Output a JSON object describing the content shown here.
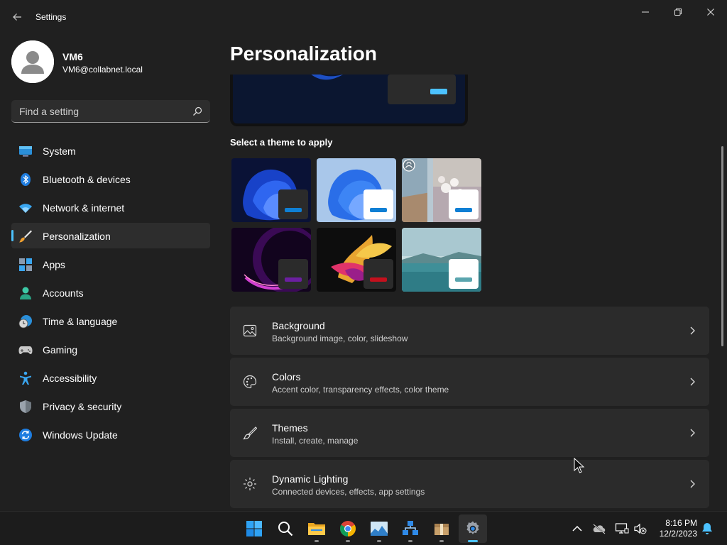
{
  "window": {
    "title": "Settings",
    "back_icon": "back-arrow-icon",
    "controls": [
      "minimize-icon",
      "restore-icon",
      "close-icon"
    ]
  },
  "profile": {
    "name": "VM6",
    "email": "VM6@collabnet.local"
  },
  "search": {
    "placeholder": "Find a setting",
    "value": ""
  },
  "sidebar": {
    "items": [
      {
        "label": "System",
        "icon": "system-monitor-icon"
      },
      {
        "label": "Bluetooth & devices",
        "icon": "bluetooth-icon"
      },
      {
        "label": "Network & internet",
        "icon": "wifi-icon"
      },
      {
        "label": "Personalization",
        "icon": "paintbrush-icon",
        "active": true
      },
      {
        "label": "Apps",
        "icon": "apps-icon"
      },
      {
        "label": "Accounts",
        "icon": "account-icon"
      },
      {
        "label": "Time & language",
        "icon": "clock-globe-icon"
      },
      {
        "label": "Gaming",
        "icon": "gamepad-icon"
      },
      {
        "label": "Accessibility",
        "icon": "accessibility-icon"
      },
      {
        "label": "Privacy & security",
        "icon": "shield-icon"
      },
      {
        "label": "Windows Update",
        "icon": "update-icon"
      }
    ]
  },
  "main": {
    "title": "Personalization",
    "theme_heading": "Select a theme to apply",
    "themes": [
      {
        "name": "windows-dark",
        "accent": "#0f7fd4",
        "window": "#2b2b2b"
      },
      {
        "name": "windows-light",
        "accent": "#0f7fd4",
        "window": "#ffffff"
      },
      {
        "name": "spotlight",
        "accent": "#0f7fd4",
        "window": "#ffffff"
      },
      {
        "name": "glow",
        "accent": "#6b1fa0",
        "window": "#2b2b2b"
      },
      {
        "name": "captured-motion",
        "accent": "#c4101d",
        "window": "#2b2b2b"
      },
      {
        "name": "flow",
        "accent": "#5aa5ae",
        "window": "#ffffff"
      }
    ],
    "cards": [
      {
        "title": "Background",
        "subtitle": "Background image, color, slideshow",
        "icon": "image-icon"
      },
      {
        "title": "Colors",
        "subtitle": "Accent color, transparency effects, color theme",
        "icon": "palette-icon"
      },
      {
        "title": "Themes",
        "subtitle": "Install, create, manage",
        "icon": "brush-icon"
      },
      {
        "title": "Dynamic Lighting",
        "subtitle": "Connected devices, effects, app settings",
        "icon": "lighting-icon"
      }
    ]
  },
  "taskbar": {
    "apps": [
      "start-icon",
      "search-icon",
      "file-explorer-icon",
      "chrome-icon",
      "photos-icon",
      "network-app-icon",
      "package-icon",
      "settings-icon"
    ],
    "tray": [
      "chevron-up-icon",
      "onedrive-icon",
      "network-icon",
      "volume-muted-icon",
      "notification-bell-icon"
    ],
    "time": "8:16 PM",
    "date": "12/2/2023"
  },
  "colors": {
    "background": "#202020",
    "accent": "#4cc2ff",
    "card": "#2b2b2b"
  }
}
